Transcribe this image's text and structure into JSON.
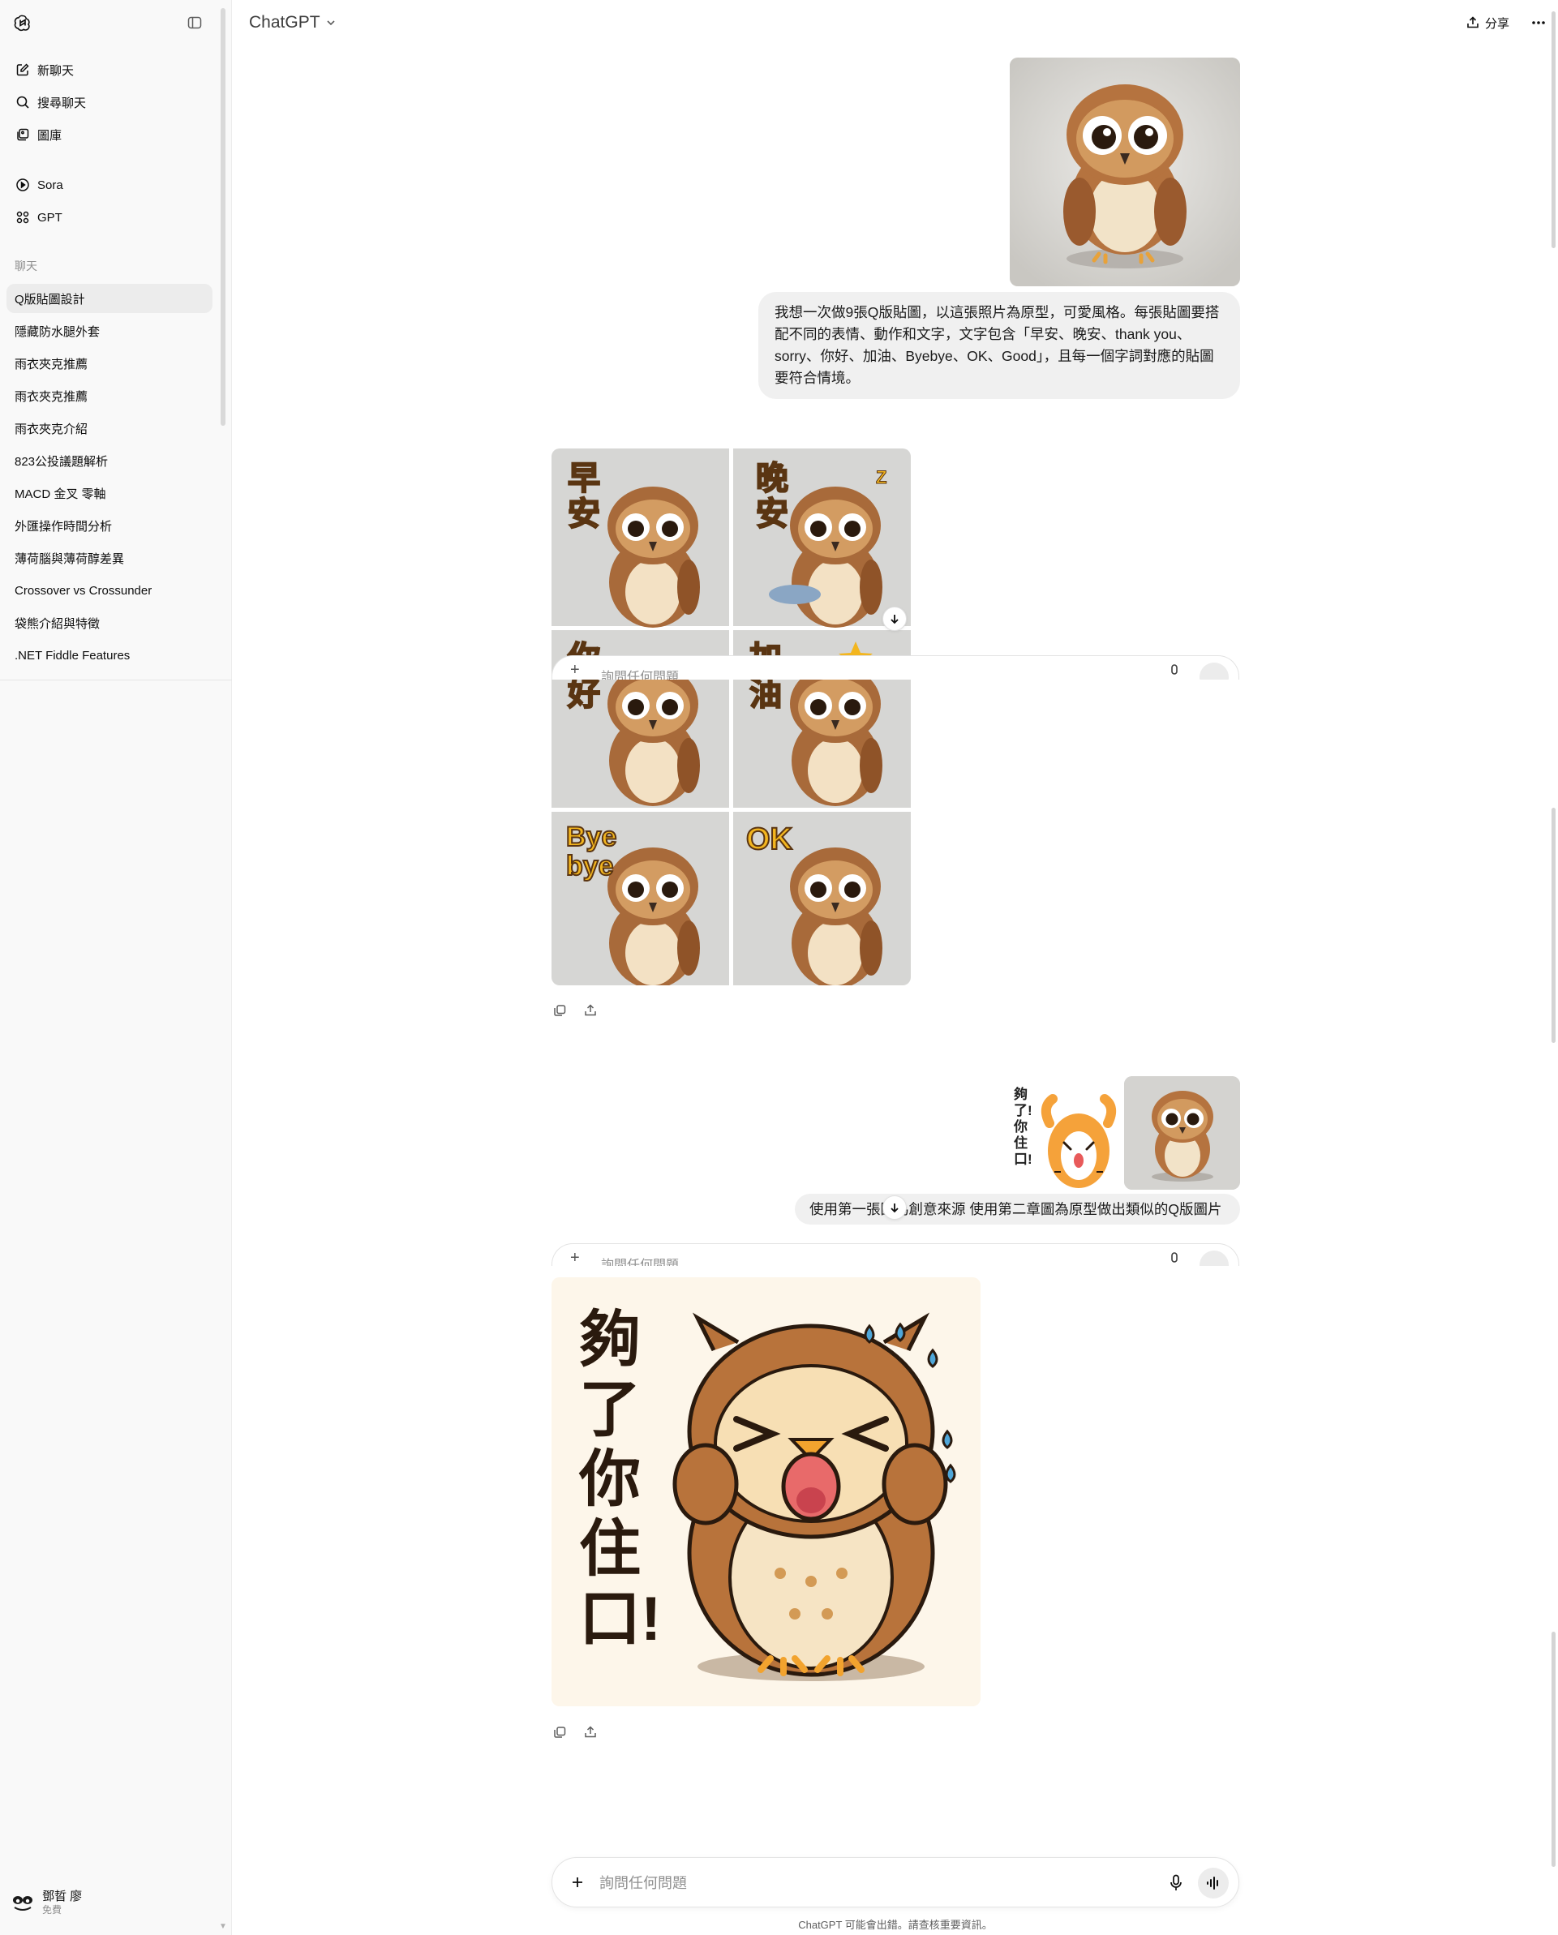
{
  "sidebar": {
    "nav": [
      {
        "label": "新聊天",
        "icon": "new-chat-icon"
      },
      {
        "label": "搜尋聊天",
        "icon": "search-icon"
      },
      {
        "label": "圖庫",
        "icon": "gallery-icon"
      }
    ],
    "apps": [
      {
        "label": "Sora",
        "icon": "sora-play-icon"
      },
      {
        "label": "GPT",
        "icon": "gpt-grid-icon"
      }
    ],
    "section_label": "聊天",
    "chats": [
      {
        "label": "Q版貼圖設計",
        "active": true
      },
      {
        "label": "隱藏防水腿外套",
        "active": false
      },
      {
        "label": "雨衣夾克推薦",
        "active": false
      },
      {
        "label": "雨衣夾克推薦",
        "active": false
      },
      {
        "label": "雨衣夾克介紹",
        "active": false
      },
      {
        "label": "823公投議題解析",
        "active": false
      },
      {
        "label": "MACD 金叉 零軸",
        "active": false
      },
      {
        "label": "外匯操作時間分析",
        "active": false
      },
      {
        "label": "薄荷腦與薄荷醇差異",
        "active": false
      },
      {
        "label": "Crossover vs Crossunder",
        "active": false
      },
      {
        "label": "袋熊介紹與特徵",
        "active": false
      },
      {
        "label": ".NET Fiddle Features",
        "active": false
      }
    ],
    "user": {
      "name": "鄧晢 廖",
      "plan": "免費"
    }
  },
  "header": {
    "model": "ChatGPT",
    "share_label": "分享"
  },
  "messages": {
    "user1_text": "我想一次做9張Q版貼圖，以這張照片為原型，可愛風格。每張貼圖要搭配不同的表情、動作和文字，文字包含「早安、晚安、thank you、sorry、你好、加油、Byebye、OK、Good」，且每一個字詞對應的貼圖要符合情境。",
    "sticker_grid": [
      {
        "text": "早安"
      },
      {
        "text": "晚安",
        "extra": "Z"
      },
      {
        "text": "你好"
      },
      {
        "text": "加油"
      },
      {
        "text": "Bye bye"
      },
      {
        "text": "OK"
      }
    ],
    "user2_text": "使用第一張圖為創意來源 使用第二章圖為原型做出類似的Q版圖片",
    "cat_sticker_text": "夠了!你住口!",
    "final_sticker_text": "夠了你住口!"
  },
  "composer": {
    "placeholder": "詢問任何問題",
    "disclaimer": "ChatGPT 可能會出錯。請查核重要資訊。"
  },
  "colors": {
    "sidebar_bg": "#f9f9f9",
    "bubble_bg": "#f0f0f0",
    "owl_brown": "#a86a3a",
    "owl_cream": "#f3e1c4"
  }
}
